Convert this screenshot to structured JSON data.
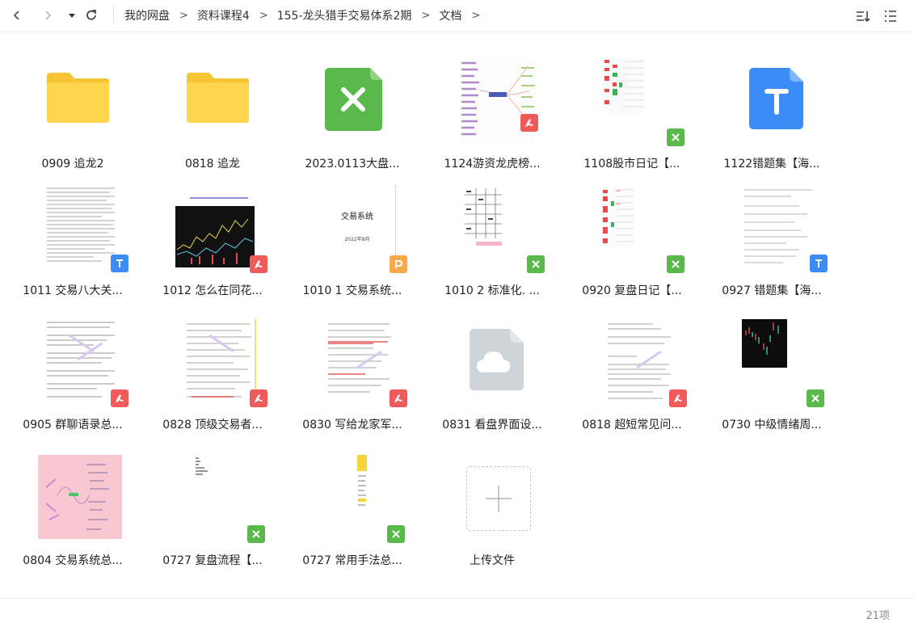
{
  "breadcrumb": [
    "我的网盘",
    "资料课程4",
    "155-龙头猎手交易体系2期",
    "文档"
  ],
  "items": [
    {
      "name": "0909 追龙2",
      "kind": "folder"
    },
    {
      "name": "0818 追龙",
      "kind": "folder"
    },
    {
      "name": "2023.0113大盘...",
      "kind": "excel-app"
    },
    {
      "name": "1124游资龙虎榜...",
      "kind": "pdf"
    },
    {
      "name": "1108股市日记【...",
      "kind": "xls"
    },
    {
      "name": "1122错题集【海...",
      "kind": "text-app"
    },
    {
      "name": "1011 交易八大关...",
      "kind": "txt"
    },
    {
      "name": "1012 怎么在同花...",
      "kind": "pdf"
    },
    {
      "name": "1010 1 交易系统...",
      "kind": "ppt"
    },
    {
      "name": "1010 2 标准化. ...",
      "kind": "xls"
    },
    {
      "name": "0920 复盘日记【...",
      "kind": "xls"
    },
    {
      "name": "0927 错题集【海...",
      "kind": "txt"
    },
    {
      "name": "0905 群聊语录总...",
      "kind": "pdf"
    },
    {
      "name": "0828 顶级交易者...",
      "kind": "pdf"
    },
    {
      "name": "0830 写给龙家军...",
      "kind": "pdf"
    },
    {
      "name": "0831 看盘界面设...",
      "kind": "cloud"
    },
    {
      "name": "0818 超短常见问...",
      "kind": "pdf"
    },
    {
      "name": "0730 中级情绪周...",
      "kind": "xls"
    },
    {
      "name": "0804 交易系统总...",
      "kind": "mindmap"
    },
    {
      "name": "0727 复盘流程【...",
      "kind": "xls"
    },
    {
      "name": "0727 常用手法总...",
      "kind": "xls"
    }
  ],
  "upload": {
    "label": "上传文件"
  },
  "thumbText": {
    "title": "交易系统",
    "date": "2022年8月"
  },
  "footer": {
    "count": "21项"
  },
  "colors": {
    "folder": "#ffd54f",
    "excel": "#5ab94b",
    "text": "#3b8cf5",
    "pdf": "#ef5b5b",
    "ppt": "#f5a94a",
    "xls": "#5ab94b"
  }
}
